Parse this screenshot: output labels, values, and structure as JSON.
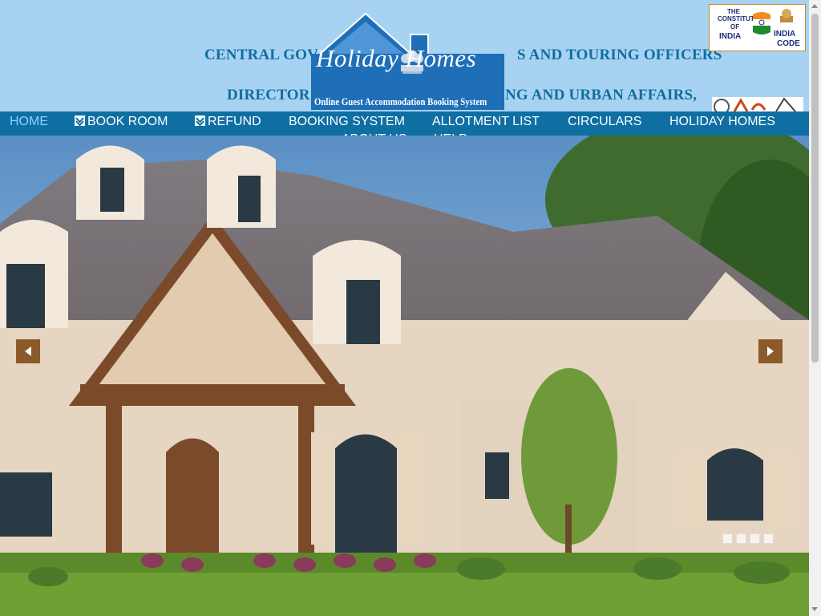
{
  "header": {
    "line1_left": "CENTRAL GOV",
    "line1_right": "S AND TOURING OFFICERS",
    "line2_left": "DIRECTOR",
    "line2_right": "NG AND URBAN AFFAIRS,"
  },
  "logo": {
    "title": "Holiday Homes",
    "subtitle": "Online Guest Accommodation Booking System"
  },
  "badge": {
    "line1": "THE",
    "line2": "CONSTITUTION",
    "line3": "OF",
    "line4": "INDIA",
    "line5": "INDIA",
    "line6": "CODE"
  },
  "nav": {
    "home": "HOME",
    "book_room": "BOOK ROOM",
    "refund": "REFUND",
    "booking_system": "BOOKING SYSTEM",
    "allotment_list": "ALLOTMENT LIST",
    "circulars": "CIRCULARS",
    "holiday_homes": "HOLIDAY HOMES",
    "about_us": "ABOUT US",
    "help": "HELP"
  },
  "slider": {
    "slide_count": 4,
    "active_slide": 1
  },
  "colors": {
    "header_bg": "#a8d2f2",
    "nav_bg": "#0f6fa3",
    "header_text": "#0f6e9e",
    "arrow_bg": "#8a5a2a",
    "logo_blue": "#1f6fb8"
  }
}
